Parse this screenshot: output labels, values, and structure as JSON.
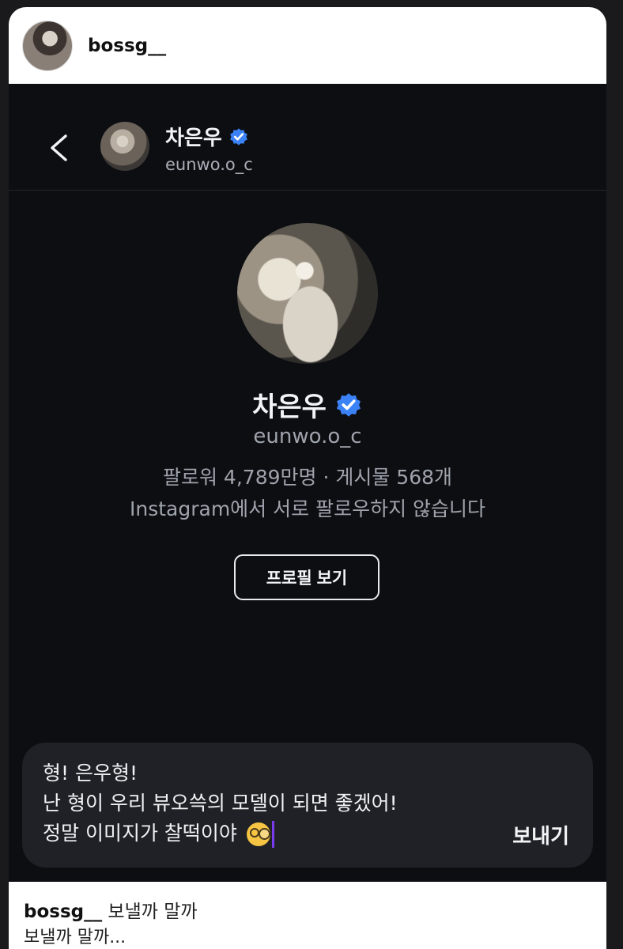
{
  "story": {
    "username": "bossg__"
  },
  "dm_header": {
    "name": "차은우",
    "handle": "eunwo.o_c"
  },
  "profile": {
    "name": "차은우",
    "handle": "eunwo.o_c",
    "stats": "팔로워 4,789만명 · 게시물 568개",
    "note": "Instagram에서 서로 팔로우하지 않습니다",
    "view_profile_label": "프로필 보기"
  },
  "compose": {
    "lines": [
      "형! 은우형!",
      "난 형이 우리 뷰오쓱의 모델이 되면 좋겠어!",
      "정말 이미지가 찰떡이야"
    ],
    "emoji": "face-with-monocle",
    "send_label": "보내기"
  },
  "caption": {
    "username": "bossg__",
    "text": "보낼까 말까",
    "second_line": "보낼까 말까..."
  },
  "colors": {
    "background": "#0d0e12",
    "verified": "#3b82f6",
    "caret": "#7b3cf0",
    "muted_text": "#9fa3ac"
  }
}
